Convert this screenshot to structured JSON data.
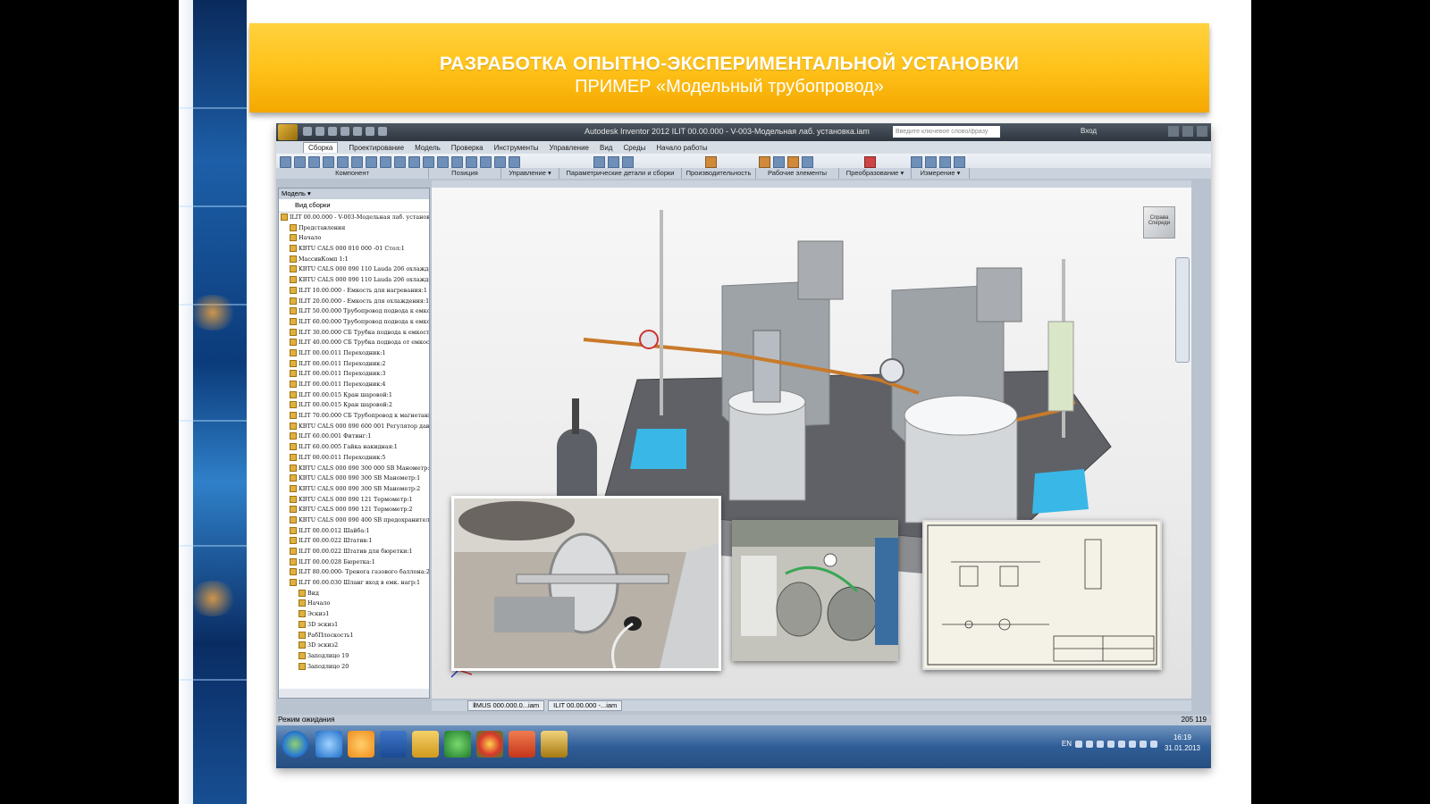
{
  "slide": {
    "title_line1": "РАЗРАБОТКА  ОПЫТНО-ЭКСПЕРИМЕНТАЛЬНОЙ УСТАНОВКИ",
    "title_line2": "ПРИМЕР «Модельный  трубопровод»"
  },
  "app": {
    "window_title": "Autodesk Inventor 2012   ILIT 00.00.000 - V-003-Модельная лаб. установка.iam",
    "search_placeholder": "Введите ключевое слово/фразу",
    "login_label": "Вход",
    "tabs": [
      "Сборка",
      "Проектирование",
      "Модель",
      "Проверка",
      "Инструменты",
      "Управление",
      "Вид",
      "Среды",
      "Начало работы"
    ],
    "ribbon_groups": [
      "Компонент",
      "Позиция",
      "Управление ▾",
      "Параметрические детали и сборки",
      "Производительность",
      "Рабочие элементы",
      "Преобразование ▾",
      "Измерение ▾"
    ],
    "browser": {
      "header": "Модель ▾",
      "view_selector": "Вид сборки",
      "items": [
        "ILIT 00.00.000 - V-003-Модельная лаб. установка.ia",
        "Представления",
        "Начало",
        "KBTU CALS 000 010  000 -01 Стол:1",
        "МассивКомп 1:1",
        "KBTU CALS 000 090  110 Lauda 206 охлаждения:1",
        "KBTU CALS 000 090  110 Lauda 206 охлаждения:2",
        "ILIT 10.00.000 - Емкость для нагревания:1",
        "ILIT 20.00.000 - Емкость для охлаждения:1",
        "ILIT 50.00.000 Трубопровод подвода к емкости ох",
        "ILIT 60.00.000 Трубопровод подвода к емкости ох",
        "ILIT 30.00.000 СБ Трубка подвода к емкости нагр",
        "ILIT 40.00.000 СБ Трубка подвода от емкости нагр",
        "ILIT 00.00.011 Переходник:1",
        "ILIT 00.00.011 Переходник:2",
        "ILIT 00.00.011 Переходник:3",
        "ILIT 00.00.011 Переходник:4",
        "ILIT 00.00.015 Кран шаровой:1",
        "ILIT 00.00.015 Кран шаровой:2",
        "ILIT 70.00.000 СБ Трубопровод к магнетанию давл",
        "KBTU CALS 000 090  600 001 Регулятор давления",
        "ILIT 60.00.001 Фитинг:1",
        "ILIT 60.00.005 Гайка накидная:1",
        "ILIT 00.00.011 Переходник:5",
        "KBTU CALS 000 090  300  000 SB Манометр:1",
        "KBTU CALS 000 090  300 SB Манометр:1",
        "KBTU CALS 000 090  300 SB Манометр:2",
        "KBTU CALS 000 090  121 Термометр:1",
        "KBTU CALS 000 090  121 Термометр:2",
        "KBTU CALS 000 090  400 SB предохранительные к",
        "ILIT 00.00.012 Шайба:1",
        "ILIT 00.00.022 Штатив:1",
        "ILIT 00.00.022 Штатив для бюретки:1",
        "ILIT 00.00.028 Бюретка:1",
        "ILIT 80.00.000- Тренога газового баллона:2",
        "ILIT 00.00.030 Шланг вход в емк. нагр:1",
        "Вид",
        "Начало",
        "Эскиз1",
        "3D эскиз1",
        "РабПлоскость1",
        "3D эскиз2",
        "Заподлицо 19",
        "Заподлицо 20"
      ]
    },
    "doc_tabs": [
      "ⅡMUS 000.000.0...iam",
      "ILIT 00.00.000 -...iam"
    ],
    "status_text": "Режим ожидания",
    "status_numbers": "205   119",
    "view_cube_labels": [
      "Справа",
      "Спереди"
    ]
  },
  "taskbar": {
    "lang": "EN",
    "time": "16:19",
    "date": "31.01.2013"
  }
}
